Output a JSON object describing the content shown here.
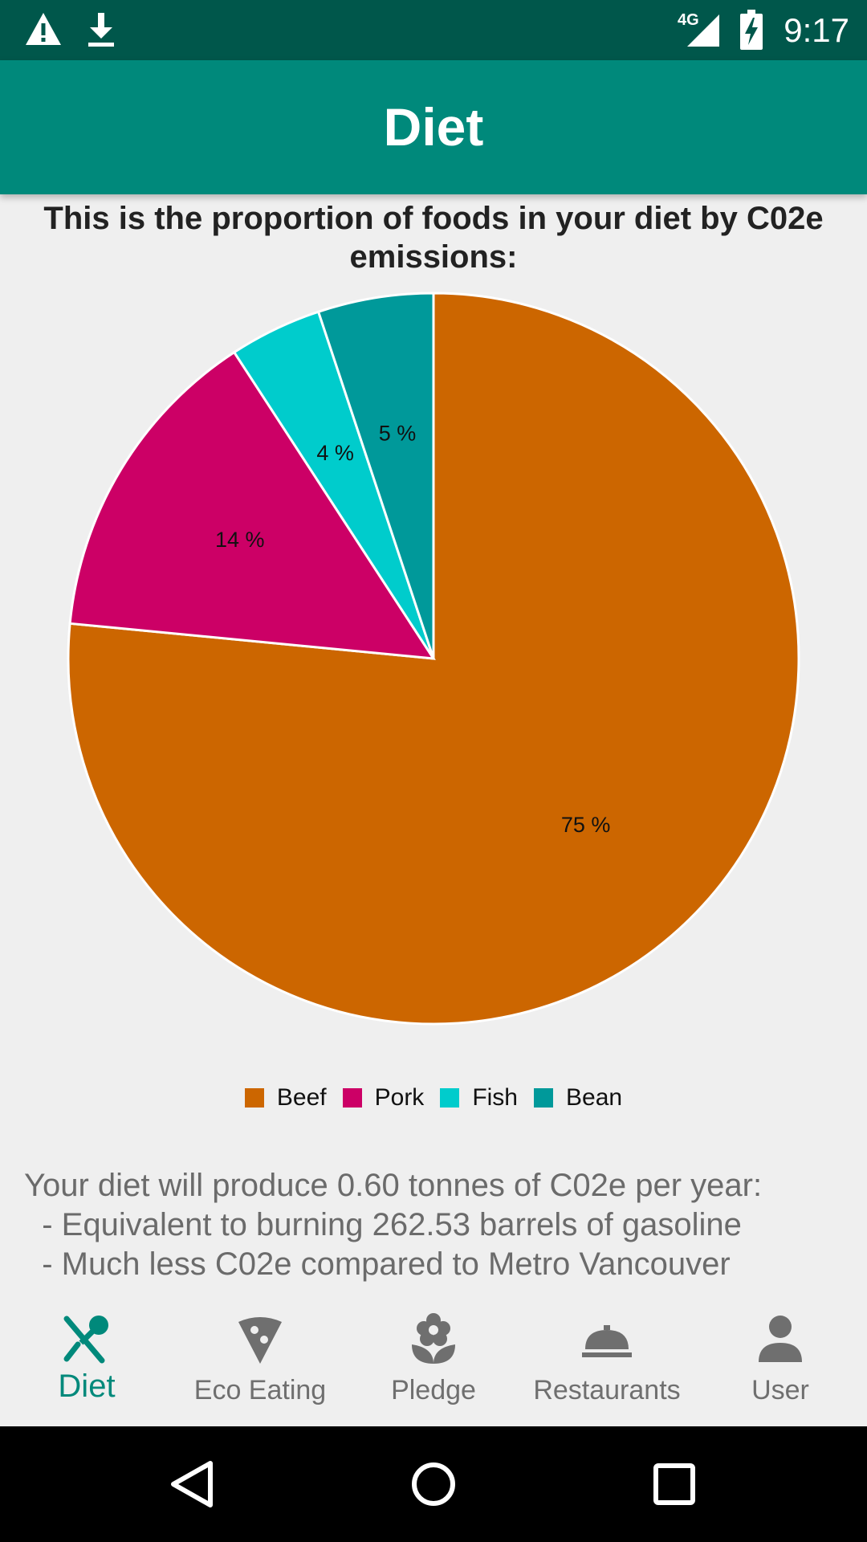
{
  "status_bar": {
    "time": "9:17",
    "network": "4G",
    "icons": [
      "warning-icon",
      "download-icon",
      "signal-icon",
      "battery-charging-icon"
    ]
  },
  "app_bar": {
    "title": "Diet"
  },
  "chart_caption": "This is the proportion of foods in your diet by C02e emissions:",
  "chart_data": {
    "type": "pie",
    "title": "",
    "slices": [
      {
        "label": "Beef",
        "value": 75,
        "display": "75 %",
        "color": "#cc6600"
      },
      {
        "label": "Pork",
        "value": 14,
        "display": "14 %",
        "color": "#cc0066"
      },
      {
        "label": "Fish",
        "value": 4,
        "display": "4 %",
        "color": "#00cccc"
      },
      {
        "label": "Bean",
        "value": 5,
        "display": "5 %",
        "color": "#00999a"
      }
    ],
    "legend_position": "bottom-center"
  },
  "summary": {
    "line1": "Your diet will produce 0.60 tonnes of C02e per year:",
    "line2": "  - Equivalent to burning 262.53 barrels of gasoline",
    "line3": "  - Much less C02e compared to Metro Vancouver"
  },
  "bottom_nav": {
    "items": [
      {
        "label": "Diet",
        "icon": "utensils-icon",
        "active": true
      },
      {
        "label": "Eco Eating",
        "icon": "pizza-slice-icon",
        "active": false
      },
      {
        "label": "Pledge",
        "icon": "flower-icon",
        "active": false
      },
      {
        "label": "Restaurants",
        "icon": "room-service-icon",
        "active": false
      },
      {
        "label": "User",
        "icon": "user-icon",
        "active": false
      }
    ]
  },
  "colors": {
    "status_bar": "#00574b",
    "app_bar": "#00897b",
    "accent": "#00897b",
    "inactive": "#6f6f6f",
    "background": "#efefef"
  }
}
